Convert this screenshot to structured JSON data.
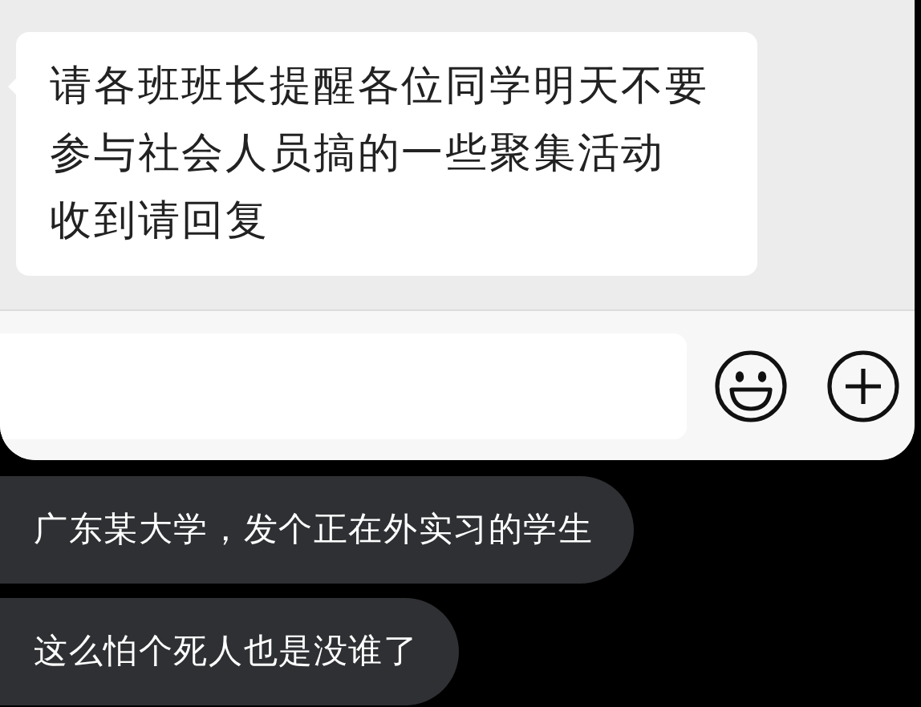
{
  "chat": {
    "messages": [
      {
        "lines": [
          "请各班班长提醒各位同学明天不要",
          "参与社会人员搞的一些聚集活动",
          "收到请回复"
        ]
      }
    ],
    "input_bar": {
      "buttons": [
        {
          "kind": "emoji"
        },
        {
          "kind": "plus"
        }
      ]
    }
  },
  "comments": [
    {
      "text": "广东某大学，发个正在外实习的学生"
    },
    {
      "text": "这么怕个死人也是没谁了"
    }
  ]
}
